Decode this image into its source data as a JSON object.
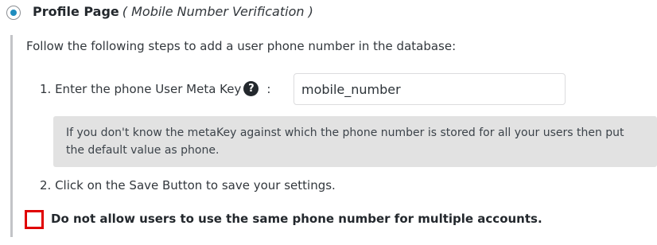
{
  "header": {
    "title": "Profile Page",
    "subtitle": "( Mobile Number Verification )"
  },
  "content": {
    "intro": "Follow the following steps to add a user phone number in the database:",
    "step1_label": "1. Enter the phone User Meta Key",
    "help_icon": "question-circle-icon",
    "help_glyph": "?",
    "colon": ":",
    "meta_key_value": "mobile_number",
    "note": "If you don't know the metaKey against which the phone number is stored for all your users then put the default value as phone.",
    "step2_label": "2. Click on the Save Button to save your settings.",
    "unique_phone_label": "Do not allow users to use the same phone number for multiple accounts.",
    "unique_phone_checked": false
  },
  "colors": {
    "accent": "#1e8cbe",
    "highlight_border": "#e00000",
    "note_background": "#e2e2e2"
  }
}
